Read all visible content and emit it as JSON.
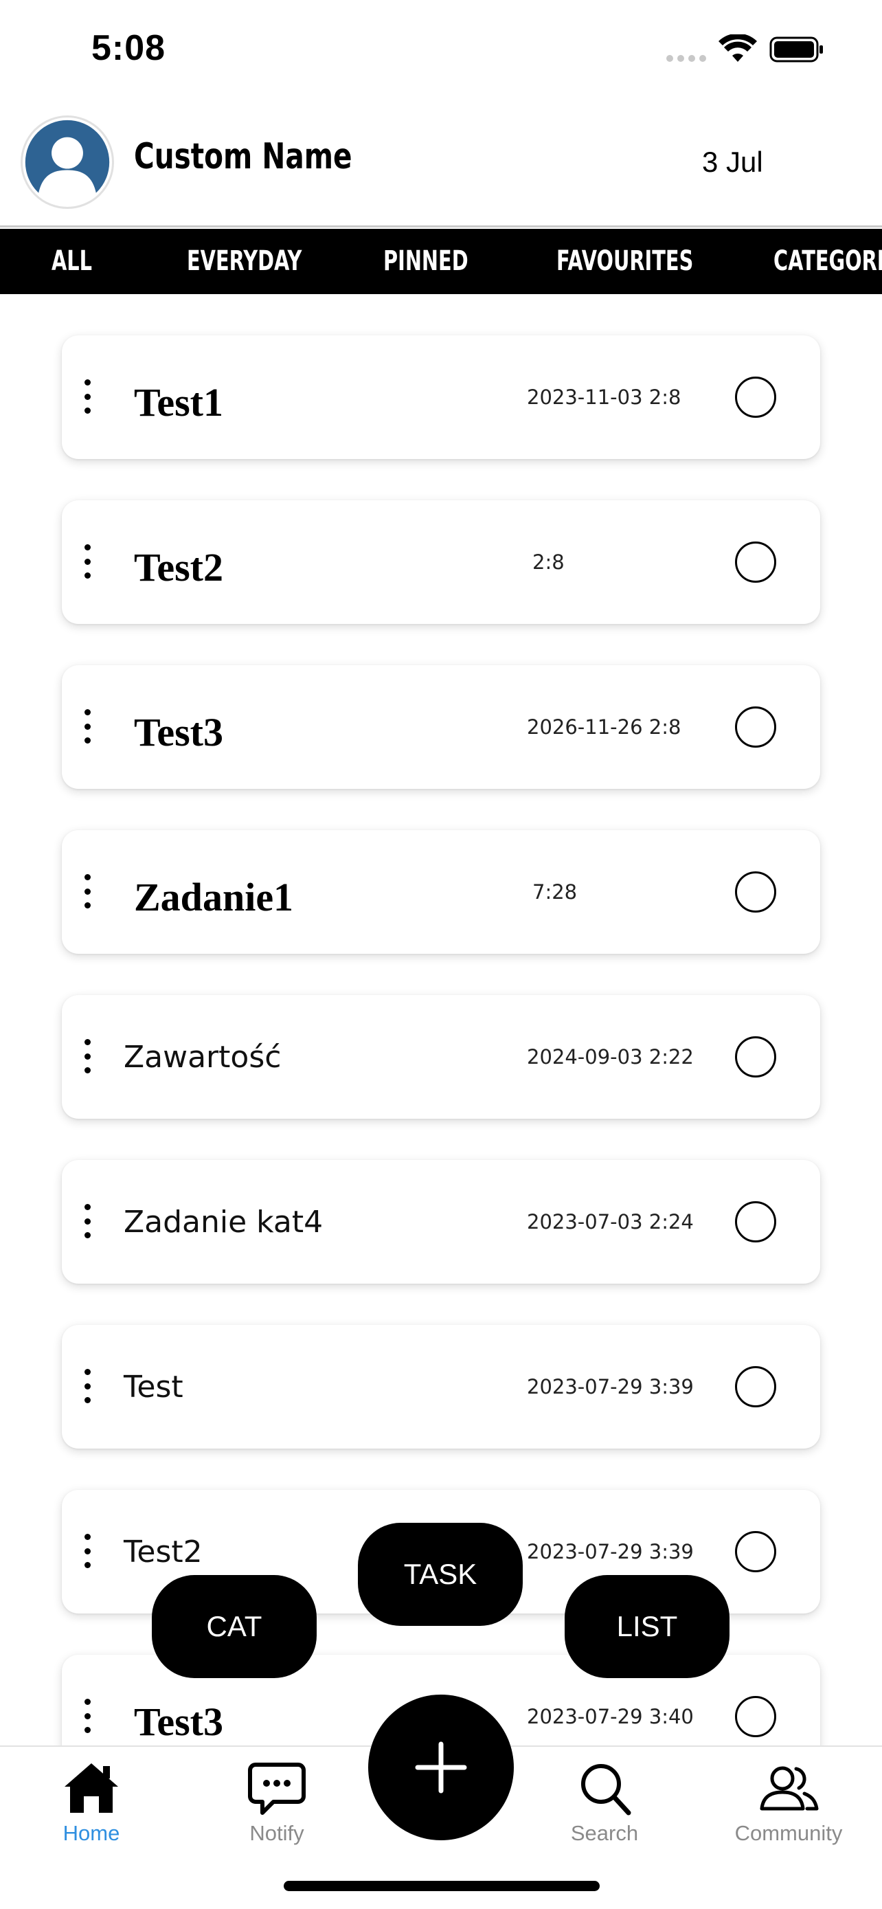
{
  "status_bar": {
    "time": "5:08"
  },
  "header": {
    "user_name": "Custom Name",
    "date": "3 Jul"
  },
  "tabs": [
    {
      "label": "ALL"
    },
    {
      "label": "EVERYDAY"
    },
    {
      "label": "PINNED"
    },
    {
      "label": "FAVOURITES"
    },
    {
      "label": "CATEGORIES"
    }
  ],
  "tasks": [
    {
      "title": "Test1",
      "date": "2023-11-03 2:8",
      "bold": true,
      "checked": false
    },
    {
      "title": "Test2",
      "date": "2:8",
      "bold": true,
      "checked": false
    },
    {
      "title": "Test3",
      "date": "2026-11-26 2:8",
      "bold": true,
      "checked": false
    },
    {
      "title": "Zadanie1",
      "date": "7:28",
      "bold": true,
      "checked": false
    },
    {
      "title": "Zawartość",
      "date": "2024-09-03 2:22",
      "bold": false,
      "checked": false
    },
    {
      "title": "Zadanie kat4",
      "date": "2023-07-03 2:24",
      "bold": false,
      "checked": false
    },
    {
      "title": "Test",
      "date": "2023-07-29 3:39",
      "bold": false,
      "checked": false
    },
    {
      "title": "Test2",
      "date": "2023-07-29 3:39",
      "bold": false,
      "checked": false
    },
    {
      "title": "Test3",
      "date": "2023-07-29 3:40",
      "bold": true,
      "checked": false
    }
  ],
  "fab_menu": {
    "task_label": "TASK",
    "cat_label": "CAT",
    "list_label": "LIST"
  },
  "bottom_nav": [
    {
      "label": "Home",
      "icon": "home-icon",
      "active": true
    },
    {
      "label": "Notify",
      "icon": "chat-bubble-icon",
      "active": false
    },
    {
      "label": "Search",
      "icon": "search-icon",
      "active": false
    },
    {
      "label": "Community",
      "icon": "community-icon",
      "active": false
    }
  ],
  "colors": {
    "accent": "#2f8fe0",
    "tab_bar": "#000000",
    "avatar": "#2e6393"
  }
}
